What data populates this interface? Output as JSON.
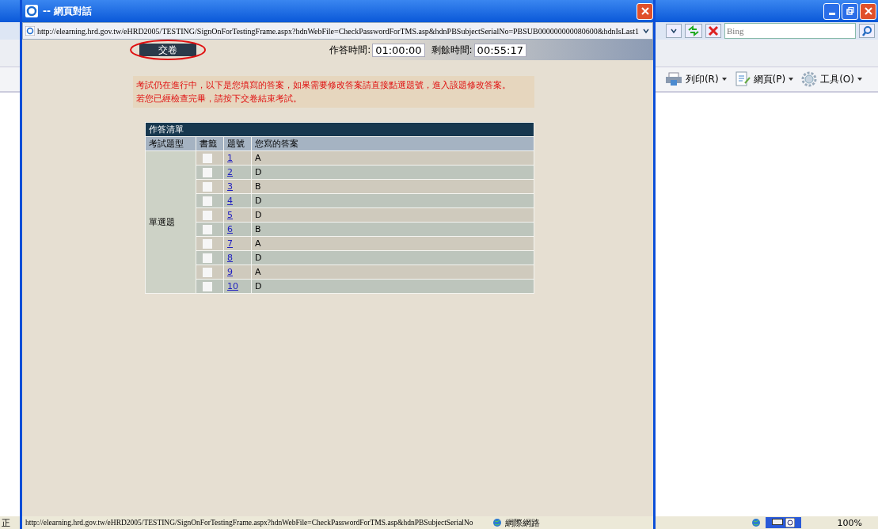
{
  "browser": {
    "search": {
      "placeholder": "Bing"
    },
    "toolbar": [
      {
        "label": "列印(R)"
      },
      {
        "label": "網頁(P)"
      },
      {
        "label": "工具(O)"
      }
    ],
    "status_text": "正",
    "zoom": "100%"
  },
  "dialog": {
    "title": "-- 網頁對話",
    "address": "http://elearning.hrd.gov.tw/eHRD2005/TESTING/SignOnForTestingFrame.aspx?hdnWebFile=CheckPasswordForTMS.asp&hdnPBSubjectSerialNo=PBSUB000000000080600&hdnIsLast1",
    "submit_button": "交卷",
    "timers": [
      {
        "label": "作答時間:",
        "value": "01:00:00"
      },
      {
        "label": "剩餘時間:",
        "value": "00:55:17"
      }
    ],
    "notice": [
      "考試仍在進行中，以下是您填寫的答案，如果需要修改答案請直接點選題號，進入該題修改答案。",
      "若您已經檢查完畢，請按下交卷結束考試。"
    ],
    "table": {
      "title": "作答清單",
      "columns": [
        "考試題型",
        "書籤",
        "題號",
        "您寫的答案"
      ],
      "group": "單選題",
      "rows": [
        {
          "number": "1",
          "checked": false,
          "answer": "A"
        },
        {
          "number": "2",
          "checked": false,
          "answer": "D"
        },
        {
          "number": "3",
          "checked": false,
          "answer": "B"
        },
        {
          "number": "4",
          "checked": false,
          "answer": "D"
        },
        {
          "number": "5",
          "checked": false,
          "answer": "D"
        },
        {
          "number": "6",
          "checked": false,
          "answer": "B"
        },
        {
          "number": "7",
          "checked": false,
          "answer": "A"
        },
        {
          "number": "8",
          "checked": false,
          "answer": "D"
        },
        {
          "number": "9",
          "checked": false,
          "answer": "A"
        },
        {
          "number": "10",
          "checked": false,
          "answer": "D"
        }
      ]
    },
    "status_bar": {
      "url": "http://elearning.hrd.gov.tw/eHRD2005/TESTING/SignOnForTestingFrame.aspx?hdnWebFile=CheckPasswordForTMS.asp&hdnPBSubjectSerialNo",
      "zone": "網際網路"
    }
  }
}
